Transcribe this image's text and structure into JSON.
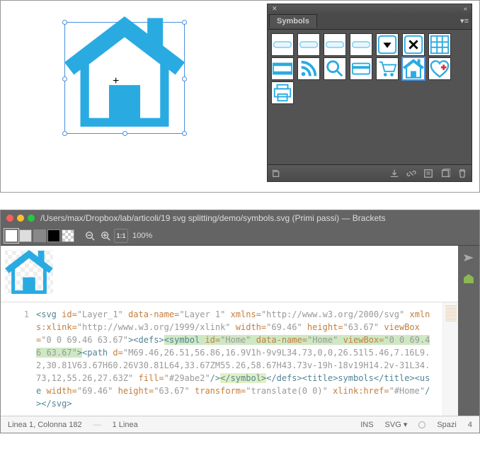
{
  "illustrator": {
    "symbols_panel": {
      "title": "Symbols"
    }
  },
  "editor": {
    "title": "/Users/max/Dropbox/lab/articoli/19 svg splitting/demo/symbols.svg (Primi passi) — Brackets",
    "zoom": "100%",
    "line_number": "1",
    "code": {
      "svg_open": "<svg",
      "id_attr": " id=",
      "id_val": "\"Layer_1\"",
      "dn_attr": " data-name=",
      "dn_val": "\"Layer 1\"",
      "xmlns_attr": " xmlns=",
      "xmlns_val": "\"http://www.w3.org/2000/svg\"",
      "xlink_attr": "xmlns:xlink=",
      "xlink_val": "\"http://www.w3.org/1999/xlink\"",
      "w_attr": " width=",
      "w_val": "\"69.46\"",
      "h_attr": " height=",
      "h_val": "\"63.67\"",
      "vb_attr": "viewBox=",
      "vb_val": "\"0 0 69.46 63.67\"",
      "gt": ">",
      "defs_open": "<defs>",
      "sym_open": "<symbol",
      "sym_id_attr": " id=",
      "sym_id_val": "\"Home\"",
      "sym_dn_attr": " data-name=",
      "sym_dn_val": "\"Home\"",
      "sym_vb_attr": " viewBox=",
      "sym_vb_val": "\"0 0 69.46 63.67\"",
      "path_open": "<path",
      "d_attr": " d=",
      "d_val": "\"M69.46,26.51,56.86,16.9V1h-9v9L34.73,0,0,26.51l5.46,7.16L9.2,30.81V63.67H60.26V30.81L64,33.67ZM55.26,58.67H43.73v-19h-18v19H14.2v-31L34.73,12,55.26,27.63Z\"",
      "fill_attr": " fill=",
      "fill_val": "\"#29abe2\"",
      "sl": "/>",
      "sym_close": "</symbol>",
      "defs_close": "</defs>",
      "title_el": "<title>symbols</title>",
      "use_open": "<use",
      "u_w_attr": " width=",
      "u_w_val": "\"69.46\"",
      "u_h_attr": " height=",
      "u_h_val": "\"63.67\"",
      "u_tr_attr": "transform=",
      "u_tr_val": "\"translate(0 0)\"",
      "u_href_attr": " xlink:href=",
      "u_href_val": "\"#Home\"",
      "svg_close": "</svg>"
    },
    "status": {
      "cursor": "Linea 1, Colonna 182",
      "lines": "1 Linea",
      "ins": "INS",
      "lang": "SVG",
      "spaces": "Spazi",
      "indent": "4"
    }
  }
}
